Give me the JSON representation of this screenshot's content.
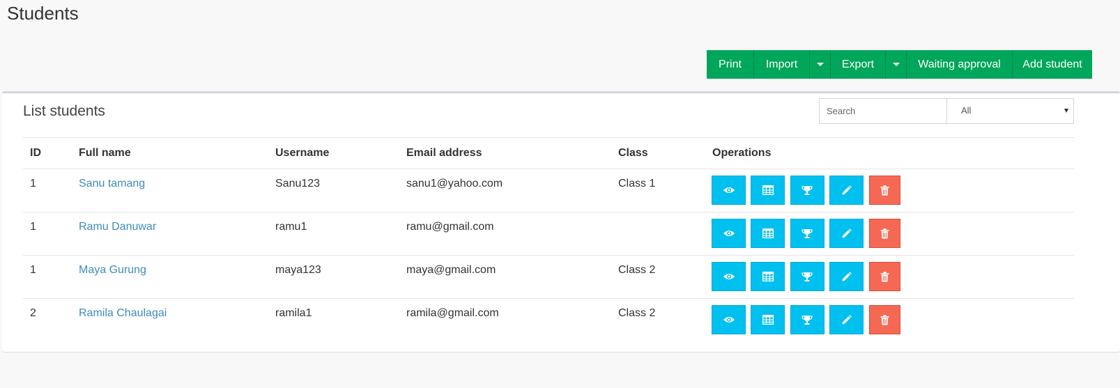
{
  "page": {
    "title": "Students"
  },
  "toolbar": {
    "print_label": "Print",
    "import_label": "Import",
    "export_label": "Export",
    "waiting_label": "Waiting approval",
    "add_label": "Add student"
  },
  "panel": {
    "title": "List students",
    "search_placeholder": "Search",
    "filter_selected": "All"
  },
  "table": {
    "headers": {
      "id": "ID",
      "fullname": "Full name",
      "username": "Username",
      "email": "Email address",
      "class": "Class",
      "operations": "Operations"
    },
    "rows": [
      {
        "id": "1",
        "fullname": "Sanu tamang",
        "username": "Sanu123",
        "email": "sanu1@yahoo.com",
        "class": "Class 1"
      },
      {
        "id": "1",
        "fullname": "Ramu Danuwar",
        "username": "ramu1",
        "email": "ramu@gmail.com",
        "class": ""
      },
      {
        "id": "1",
        "fullname": "Maya Gurung",
        "username": "maya123",
        "email": "maya@gmail.com",
        "class": "Class 2"
      },
      {
        "id": "2",
        "fullname": "Ramila Chaulagai",
        "username": "ramila1",
        "email": "ramila@gmail.com",
        "class": "Class 2"
      }
    ]
  },
  "operations": [
    "eye-icon",
    "table-icon",
    "trophy-icon",
    "pencil-icon",
    "trash-icon"
  ],
  "colors": {
    "green": "#00a65a",
    "info": "#00c0ef",
    "danger": "#f56954",
    "link": "#3c8dbc"
  }
}
